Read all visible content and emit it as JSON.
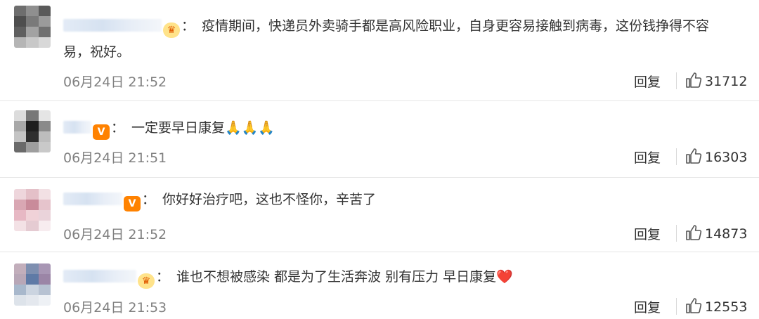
{
  "comments": [
    {
      "badge": "crown",
      "colon": "：",
      "text": "疫情期间，快递员外卖骑手都是高风险职业，自身更容易接触到病毒，这份钱挣得不容易，祝好。",
      "time": "06月24日 21:52",
      "reply_label": "回复",
      "likes": "31712",
      "avatar_colors": [
        "#6e6e6e",
        "#8f8f8f",
        "#5a5a5a",
        "#4e4e4e",
        "#7a7a7a",
        "#9b9b9b",
        "#5f5f5f",
        "#a2a2a2",
        "#707070",
        "#b5b5b5",
        "#c8c8c8",
        "#d8d8d8"
      ]
    },
    {
      "badge": "v",
      "colon": "：",
      "text": "一定要早日康复🙏🙏🙏",
      "time": "06月24日 21:51",
      "reply_label": "回复",
      "likes": "16303",
      "avatar_colors": [
        "#dcdcdc",
        "#777777",
        "#e5e5e5",
        "#a8a8a8",
        "#1e1e1e",
        "#8a8a8a",
        "#c4c4c4",
        "#2e2e2e",
        "#bdbdbd",
        "#6a6a6a",
        "#9e9e9e",
        "#c9c9c9"
      ]
    },
    {
      "badge": "v",
      "colon": "：",
      "text": "你好好治疗吧，这也不怪你，辛苦了",
      "time": "06月24日 21:52",
      "reply_label": "回复",
      "likes": "14873",
      "avatar_colors": [
        "#eed6dc",
        "#e4c0c8",
        "#f2e0e4",
        "#d9a7b3",
        "#c98b9a",
        "#e6c4cc",
        "#e7b8c4",
        "#f0d2d8",
        "#ead3da",
        "#f3e1e5",
        "#e5cbd2",
        "#f7ecef"
      ]
    },
    {
      "badge": "crown",
      "colon": "：",
      "text": "谁也不想被感染 都是为了生活奔波 别有压力 早日康复❤️",
      "time": "06月24日 21:53",
      "reply_label": "回复",
      "likes": "12553",
      "avatar_colors": [
        "#c2aebb",
        "#7e8fb0",
        "#a896b4",
        "#b8a7b7",
        "#5f7aa6",
        "#9b85a6",
        "#a8b8cc",
        "#cbd4e0",
        "#b7c2d2",
        "#dde3ea",
        "#e4e8ee",
        "#eef1f5"
      ]
    }
  ],
  "icons": {
    "crown": "crown-icon",
    "v": "verified-v-icon",
    "like": "thumbs-up-icon"
  },
  "colors": {
    "timestamp": "#808080",
    "v_badge": "#ff8200",
    "crown_badge": "#ffe38a",
    "divider": "#e6e6e6"
  }
}
